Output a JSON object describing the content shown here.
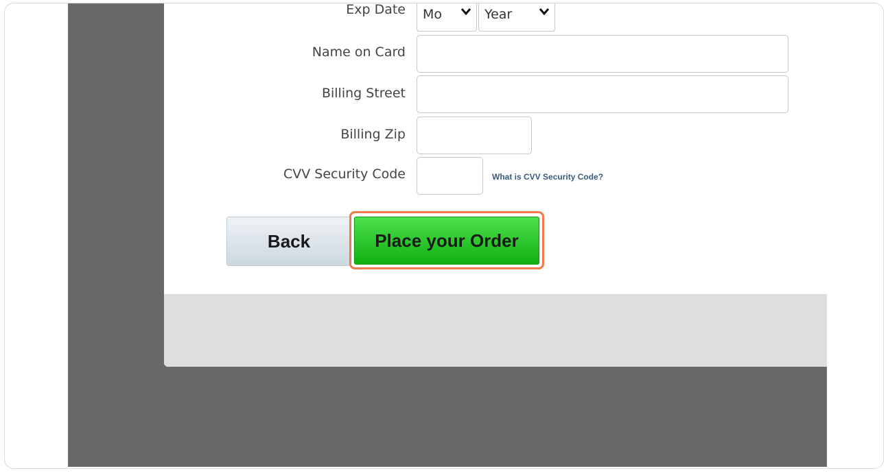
{
  "form": {
    "exp_date_label": "Exp Date",
    "exp_month_value": "Mo",
    "exp_year_value": "Year",
    "name_label": "Name on Card",
    "name_value": "",
    "street_label": "Billing Street",
    "street_value": "",
    "zip_label": "Billing Zip",
    "zip_value": "",
    "cvv_label": "CVV Security Code",
    "cvv_value": "",
    "cvv_help_link": "What is CVV Security Code?"
  },
  "buttons": {
    "back_label": "Back",
    "order_label": "Place your Order"
  },
  "icons": {
    "select_chevron": "chevron-down-icon"
  },
  "colors": {
    "order_button": "#22c322",
    "highlight_outline": "#f07a4a",
    "backdrop": "#686868"
  }
}
